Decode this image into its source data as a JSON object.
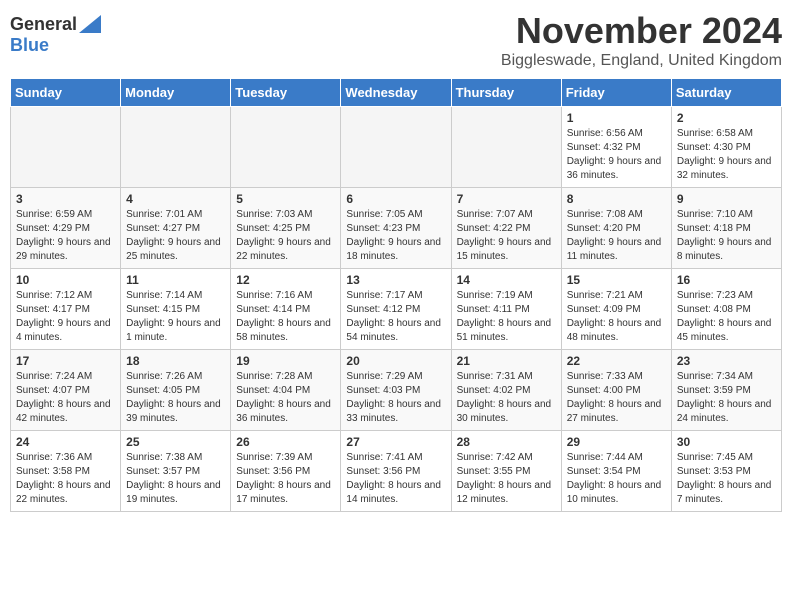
{
  "logo": {
    "general": "General",
    "blue": "Blue"
  },
  "header": {
    "month": "November 2024",
    "location": "Biggleswade, England, United Kingdom"
  },
  "days_of_week": [
    "Sunday",
    "Monday",
    "Tuesday",
    "Wednesday",
    "Thursday",
    "Friday",
    "Saturday"
  ],
  "weeks": [
    [
      {
        "day": "",
        "info": ""
      },
      {
        "day": "",
        "info": ""
      },
      {
        "day": "",
        "info": ""
      },
      {
        "day": "",
        "info": ""
      },
      {
        "day": "",
        "info": ""
      },
      {
        "day": "1",
        "info": "Sunrise: 6:56 AM\nSunset: 4:32 PM\nDaylight: 9 hours and 36 minutes."
      },
      {
        "day": "2",
        "info": "Sunrise: 6:58 AM\nSunset: 4:30 PM\nDaylight: 9 hours and 32 minutes."
      }
    ],
    [
      {
        "day": "3",
        "info": "Sunrise: 6:59 AM\nSunset: 4:29 PM\nDaylight: 9 hours and 29 minutes."
      },
      {
        "day": "4",
        "info": "Sunrise: 7:01 AM\nSunset: 4:27 PM\nDaylight: 9 hours and 25 minutes."
      },
      {
        "day": "5",
        "info": "Sunrise: 7:03 AM\nSunset: 4:25 PM\nDaylight: 9 hours and 22 minutes."
      },
      {
        "day": "6",
        "info": "Sunrise: 7:05 AM\nSunset: 4:23 PM\nDaylight: 9 hours and 18 minutes."
      },
      {
        "day": "7",
        "info": "Sunrise: 7:07 AM\nSunset: 4:22 PM\nDaylight: 9 hours and 15 minutes."
      },
      {
        "day": "8",
        "info": "Sunrise: 7:08 AM\nSunset: 4:20 PM\nDaylight: 9 hours and 11 minutes."
      },
      {
        "day": "9",
        "info": "Sunrise: 7:10 AM\nSunset: 4:18 PM\nDaylight: 9 hours and 8 minutes."
      }
    ],
    [
      {
        "day": "10",
        "info": "Sunrise: 7:12 AM\nSunset: 4:17 PM\nDaylight: 9 hours and 4 minutes."
      },
      {
        "day": "11",
        "info": "Sunrise: 7:14 AM\nSunset: 4:15 PM\nDaylight: 9 hours and 1 minute."
      },
      {
        "day": "12",
        "info": "Sunrise: 7:16 AM\nSunset: 4:14 PM\nDaylight: 8 hours and 58 minutes."
      },
      {
        "day": "13",
        "info": "Sunrise: 7:17 AM\nSunset: 4:12 PM\nDaylight: 8 hours and 54 minutes."
      },
      {
        "day": "14",
        "info": "Sunrise: 7:19 AM\nSunset: 4:11 PM\nDaylight: 8 hours and 51 minutes."
      },
      {
        "day": "15",
        "info": "Sunrise: 7:21 AM\nSunset: 4:09 PM\nDaylight: 8 hours and 48 minutes."
      },
      {
        "day": "16",
        "info": "Sunrise: 7:23 AM\nSunset: 4:08 PM\nDaylight: 8 hours and 45 minutes."
      }
    ],
    [
      {
        "day": "17",
        "info": "Sunrise: 7:24 AM\nSunset: 4:07 PM\nDaylight: 8 hours and 42 minutes."
      },
      {
        "day": "18",
        "info": "Sunrise: 7:26 AM\nSunset: 4:05 PM\nDaylight: 8 hours and 39 minutes."
      },
      {
        "day": "19",
        "info": "Sunrise: 7:28 AM\nSunset: 4:04 PM\nDaylight: 8 hours and 36 minutes."
      },
      {
        "day": "20",
        "info": "Sunrise: 7:29 AM\nSunset: 4:03 PM\nDaylight: 8 hours and 33 minutes."
      },
      {
        "day": "21",
        "info": "Sunrise: 7:31 AM\nSunset: 4:02 PM\nDaylight: 8 hours and 30 minutes."
      },
      {
        "day": "22",
        "info": "Sunrise: 7:33 AM\nSunset: 4:00 PM\nDaylight: 8 hours and 27 minutes."
      },
      {
        "day": "23",
        "info": "Sunrise: 7:34 AM\nSunset: 3:59 PM\nDaylight: 8 hours and 24 minutes."
      }
    ],
    [
      {
        "day": "24",
        "info": "Sunrise: 7:36 AM\nSunset: 3:58 PM\nDaylight: 8 hours and 22 minutes."
      },
      {
        "day": "25",
        "info": "Sunrise: 7:38 AM\nSunset: 3:57 PM\nDaylight: 8 hours and 19 minutes."
      },
      {
        "day": "26",
        "info": "Sunrise: 7:39 AM\nSunset: 3:56 PM\nDaylight: 8 hours and 17 minutes."
      },
      {
        "day": "27",
        "info": "Sunrise: 7:41 AM\nSunset: 3:56 PM\nDaylight: 8 hours and 14 minutes."
      },
      {
        "day": "28",
        "info": "Sunrise: 7:42 AM\nSunset: 3:55 PM\nDaylight: 8 hours and 12 minutes."
      },
      {
        "day": "29",
        "info": "Sunrise: 7:44 AM\nSunset: 3:54 PM\nDaylight: 8 hours and 10 minutes."
      },
      {
        "day": "30",
        "info": "Sunrise: 7:45 AM\nSunset: 3:53 PM\nDaylight: 8 hours and 7 minutes."
      }
    ]
  ]
}
